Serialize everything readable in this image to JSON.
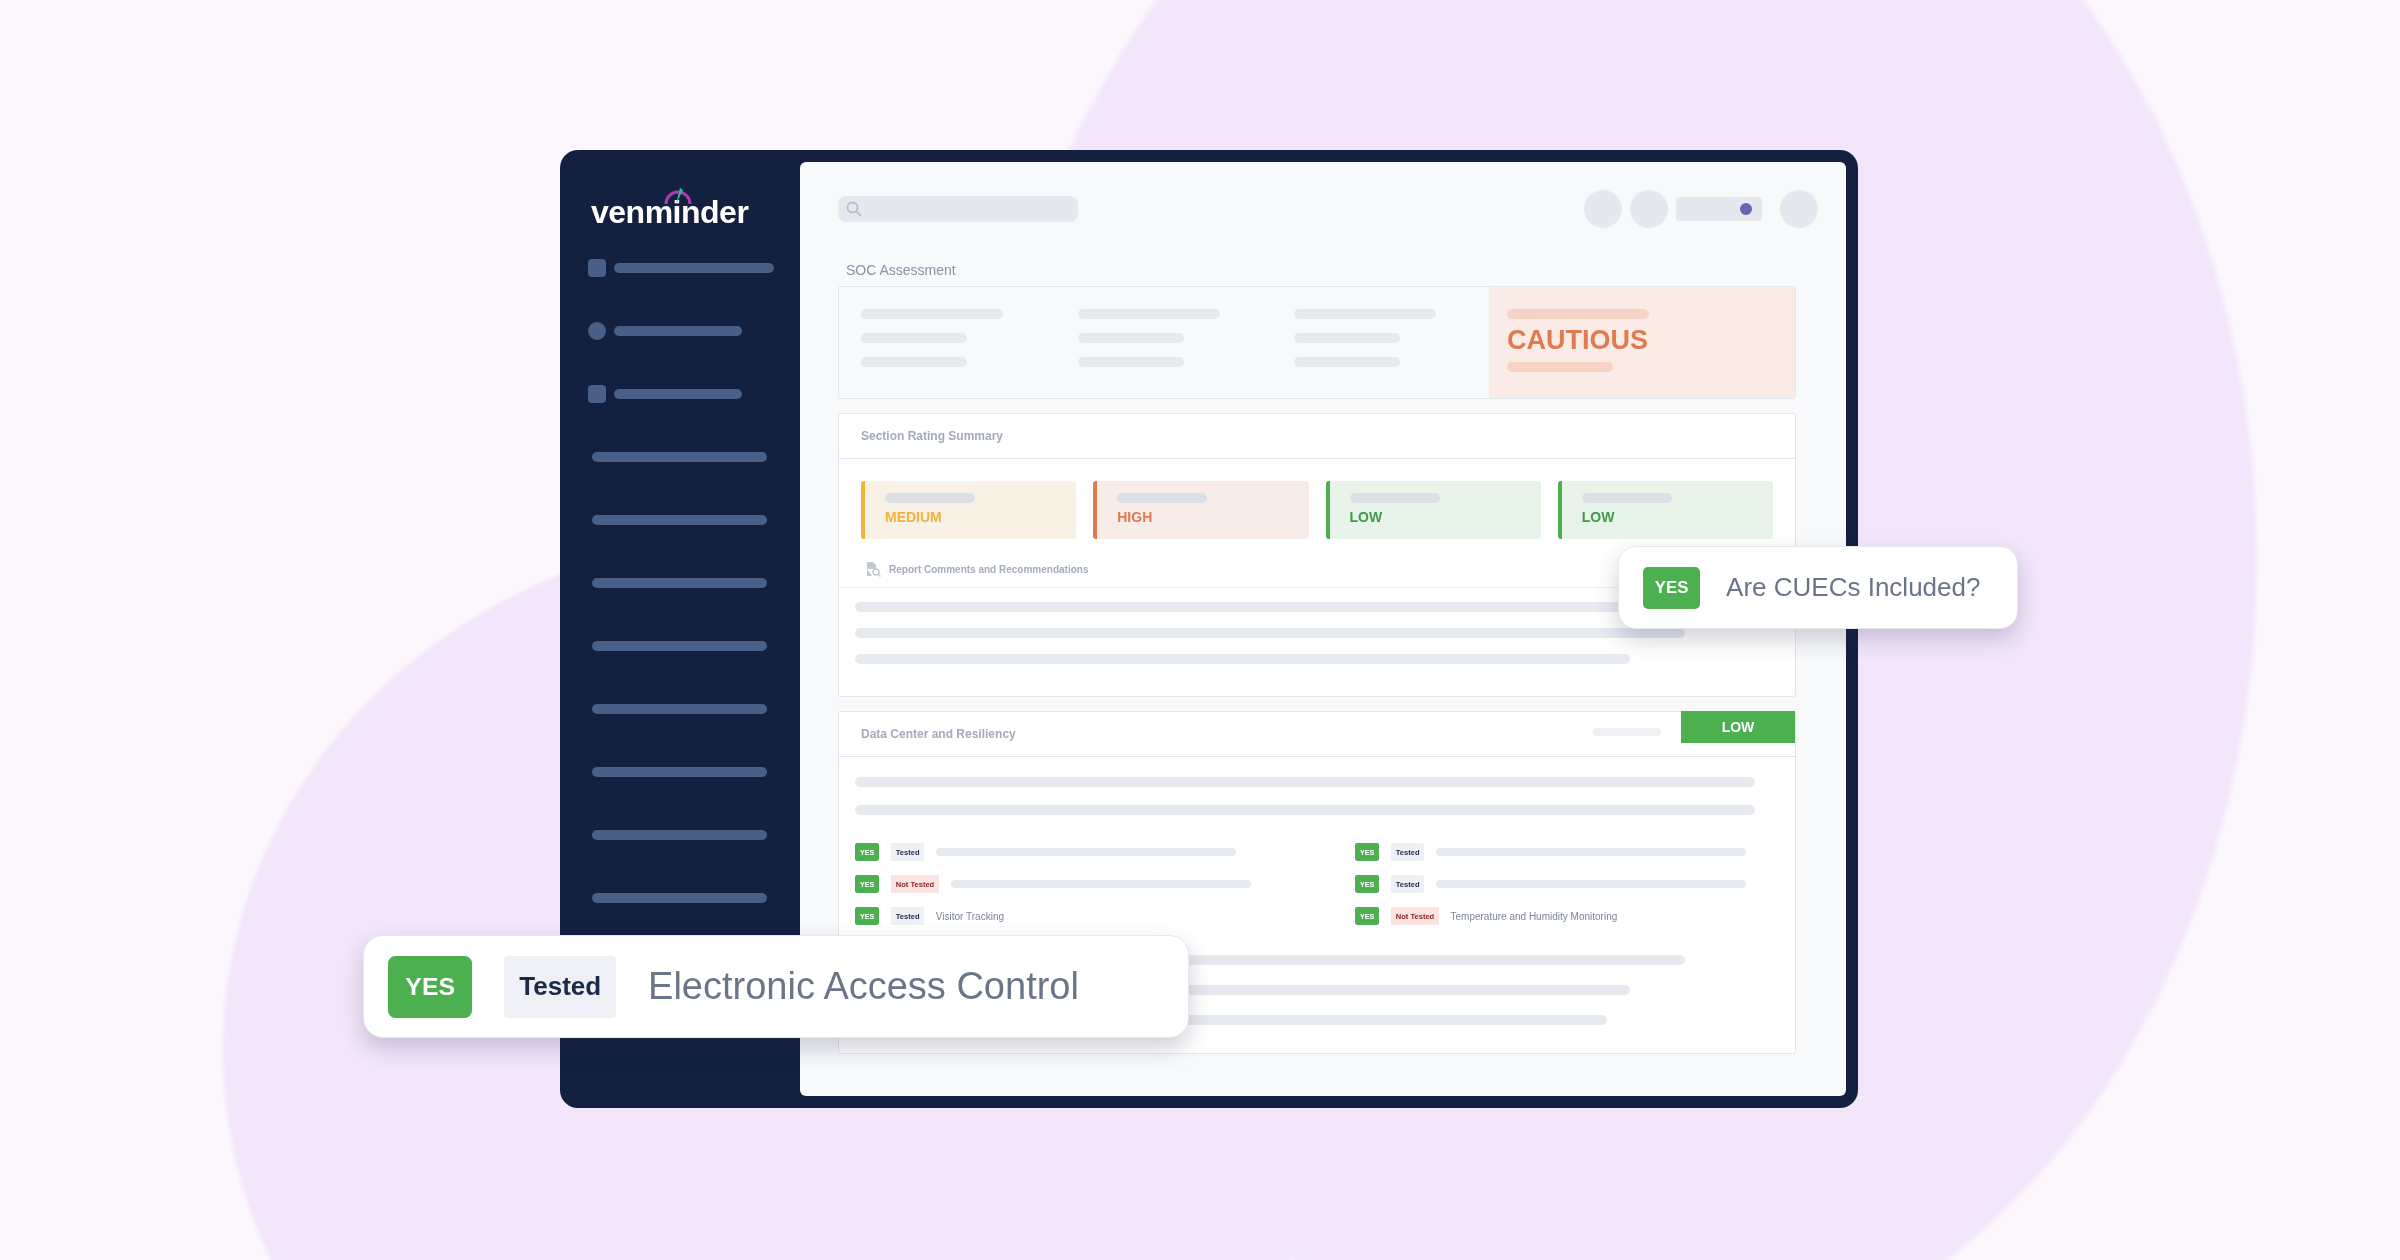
{
  "logo": {
    "text": "venminder"
  },
  "assessment": {
    "title": "SOC Assessment",
    "overall_rating": "CAUTIOUS"
  },
  "rating_summary": {
    "title": "Section Rating Summary",
    "ratings": [
      {
        "label": "MEDIUM",
        "kind": "medium"
      },
      {
        "label": "HIGH",
        "kind": "high"
      },
      {
        "label": "LOW",
        "kind": "low"
      },
      {
        "label": "LOW",
        "kind": "low"
      }
    ],
    "comments_link": "Report Comments and Recommendations"
  },
  "data_center": {
    "title": "Data Center and Resiliency",
    "rating": "LOW",
    "control_columns": [
      [
        {
          "answer": "YES",
          "status": "Tested",
          "tested": true
        },
        {
          "answer": "YES",
          "status": "Not Tested",
          "tested": false
        },
        {
          "answer": "YES",
          "status": "Tested",
          "tested": true,
          "label": "Visitor Tracking"
        }
      ],
      [
        {
          "answer": "YES",
          "status": "Tested",
          "tested": true
        },
        {
          "answer": "YES",
          "status": "Tested",
          "tested": true
        },
        {
          "answer": "YES",
          "status": "Not Tested",
          "tested": false,
          "label": "Temperature and Humidity Monitoring"
        }
      ]
    ]
  },
  "callouts": [
    {
      "kind": "small",
      "answer": "YES",
      "label": "Are CUECs Included?"
    },
    {
      "kind": "large",
      "answer": "YES",
      "status": "Tested",
      "label": "Electronic Access Control"
    }
  ]
}
